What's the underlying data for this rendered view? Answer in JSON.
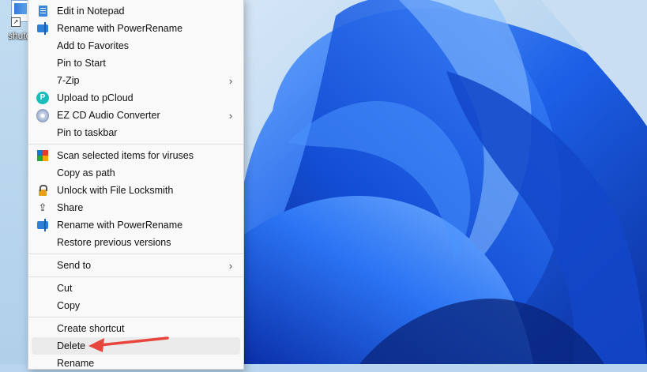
{
  "desktop": {
    "icon_label": "shutd"
  },
  "context_menu": {
    "items": [
      {
        "label": "Edit in Notepad",
        "icon": "notepad-icon",
        "submenu": false
      },
      {
        "label": "Rename with PowerRename",
        "icon": "powerrename-icon",
        "submenu": false
      },
      {
        "label": "Add to Favorites",
        "icon": "",
        "submenu": false
      },
      {
        "label": "Pin to Start",
        "icon": "",
        "submenu": false
      },
      {
        "label": "7-Zip",
        "icon": "",
        "submenu": true
      },
      {
        "label": "Upload to pCloud",
        "icon": "pcloud-icon",
        "submenu": false
      },
      {
        "label": "EZ CD Audio Converter",
        "icon": "cd-icon",
        "submenu": true
      },
      {
        "label": "Pin to taskbar",
        "icon": "",
        "submenu": false
      },
      {
        "label": "Scan selected items for viruses",
        "icon": "antivirus-icon",
        "submenu": false
      },
      {
        "label": "Copy as path",
        "icon": "",
        "submenu": false
      },
      {
        "label": "Unlock with File Locksmith",
        "icon": "lock-icon",
        "submenu": false
      },
      {
        "label": "Share",
        "icon": "share-icon",
        "submenu": false
      },
      {
        "label": "Rename with PowerRename",
        "icon": "powerrename-icon",
        "submenu": false
      },
      {
        "label": "Restore previous versions",
        "icon": "",
        "submenu": false
      },
      {
        "label": "Send to",
        "icon": "",
        "submenu": true
      },
      {
        "label": "Cut",
        "icon": "",
        "submenu": false
      },
      {
        "label": "Copy",
        "icon": "",
        "submenu": false
      },
      {
        "label": "Create shortcut",
        "icon": "",
        "submenu": false
      },
      {
        "label": "Delete",
        "icon": "",
        "submenu": false,
        "highlighted": true
      },
      {
        "label": "Rename",
        "icon": "",
        "submenu": false
      }
    ],
    "submenu_glyph": "›"
  },
  "annotation": {
    "color": "#e8453c",
    "target": "Delete"
  },
  "colors": {
    "wallpaper_blue": "#1a5fe0",
    "menu_bg": "#f9f9f9",
    "highlight_bg": "#ebebeb"
  }
}
